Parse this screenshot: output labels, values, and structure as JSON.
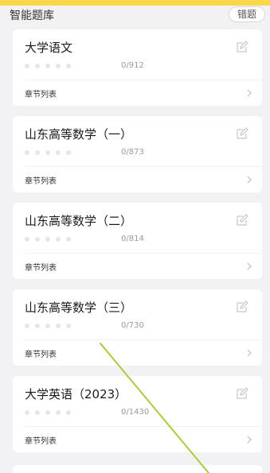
{
  "header": {
    "title": "智能题库",
    "wrong_button": "错题"
  },
  "accent_color": "#ffd64a",
  "cards": [
    {
      "title": "大学语文",
      "progress": "0/912",
      "chapter_label": "章节列表"
    },
    {
      "title": "山东高等数学（一）",
      "progress": "0/873",
      "chapter_label": "章节列表"
    },
    {
      "title": "山东高等数学（二）",
      "progress": "0/814",
      "chapter_label": "章节列表"
    },
    {
      "title": "山东高等数学（三）",
      "progress": "0/730",
      "chapter_label": "章节列表"
    },
    {
      "title": "大学英语（2023）",
      "progress": "0/1430",
      "chapter_label": "章节列表"
    }
  ],
  "icons": {
    "edit": "edit-icon",
    "chevron": "chevron-right-icon"
  }
}
